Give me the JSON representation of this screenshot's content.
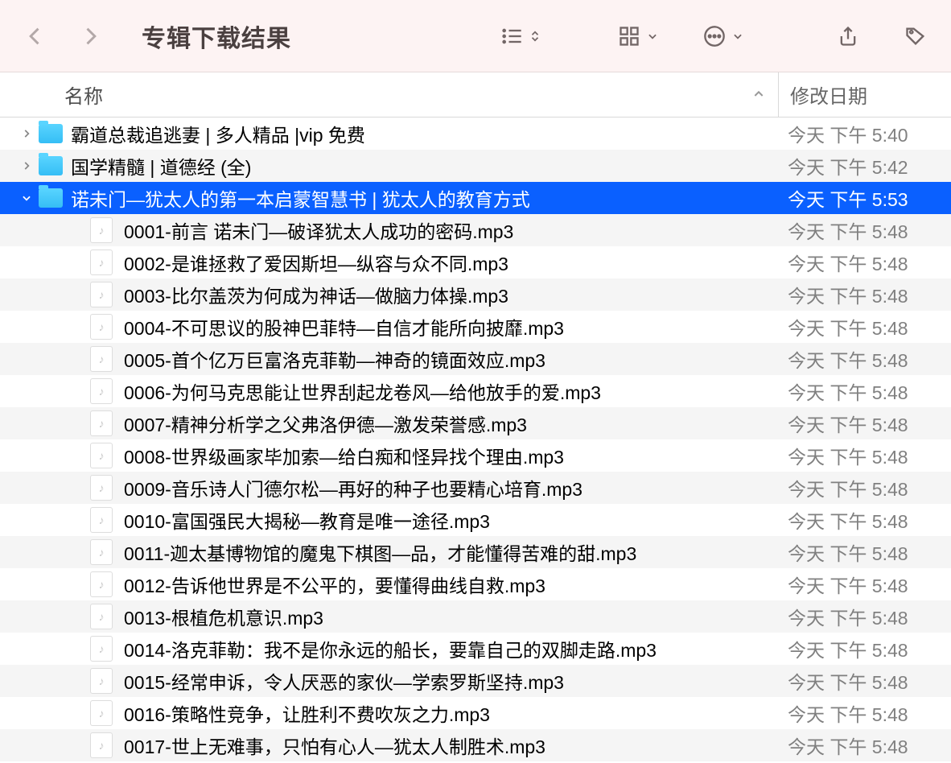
{
  "toolbar": {
    "title": "专辑下载结果"
  },
  "columns": {
    "name": "名称",
    "date": "修改日期"
  },
  "rows": [
    {
      "type": "folder",
      "depth": 0,
      "chev": "right",
      "name": "霸道总裁追逃妻 | 多人精品 |vip 免费",
      "date": "今天 下午 5:40",
      "dimDate": true,
      "selected": false
    },
    {
      "type": "folder",
      "depth": 0,
      "chev": "right",
      "name": "国学精髓 | 道德经 (全)",
      "date": "今天 下午 5:42",
      "dimDate": true,
      "selected": false
    },
    {
      "type": "folder",
      "depth": 0,
      "chev": "down",
      "name": "诺未门—犹太人的第一本启蒙智慧书 | 犹太人的教育方式",
      "date": "今天 下午 5:53",
      "dimDate": false,
      "selected": true
    },
    {
      "type": "file",
      "depth": 1,
      "name": "0001-前言 诺未门—破译犹太人成功的密码.mp3",
      "date": "今天 下午 5:48",
      "dimDate": true
    },
    {
      "type": "file",
      "depth": 1,
      "name": "0002-是谁拯救了爱因斯坦—纵容与众不同.mp3",
      "date": "今天 下午 5:48",
      "dimDate": true
    },
    {
      "type": "file",
      "depth": 1,
      "name": "0003-比尔盖茨为何成为神话—做脑力体操.mp3",
      "date": "今天 下午 5:48",
      "dimDate": true
    },
    {
      "type": "file",
      "depth": 1,
      "name": "0004-不可思议的股神巴菲特—自信才能所向披靡.mp3",
      "date": "今天 下午 5:48",
      "dimDate": true
    },
    {
      "type": "file",
      "depth": 1,
      "name": "0005-首个亿万巨富洛克菲勒—神奇的镜面效应.mp3",
      "date": "今天 下午 5:48",
      "dimDate": true
    },
    {
      "type": "file",
      "depth": 1,
      "name": "0006-为何马克思能让世界刮起龙卷风—给他放手的爱.mp3",
      "date": "今天 下午 5:48",
      "dimDate": true
    },
    {
      "type": "file",
      "depth": 1,
      "name": "0007-精神分析学之父弗洛伊德—激发荣誉感.mp3",
      "date": "今天 下午 5:48",
      "dimDate": true
    },
    {
      "type": "file",
      "depth": 1,
      "name": "0008-世界级画家毕加索—给白痴和怪异找个理由.mp3",
      "date": "今天 下午 5:48",
      "dimDate": true
    },
    {
      "type": "file",
      "depth": 1,
      "name": "0009-音乐诗人门德尔松—再好的种子也要精心培育.mp3",
      "date": "今天 下午 5:48",
      "dimDate": true
    },
    {
      "type": "file",
      "depth": 1,
      "name": "0010-富国强民大揭秘—教育是唯一途径.mp3",
      "date": "今天 下午 5:48",
      "dimDate": true
    },
    {
      "type": "file",
      "depth": 1,
      "name": "0011-迦太基博物馆的魔鬼下棋图—品，才能懂得苦难的甜.mp3",
      "date": "今天 下午 5:48",
      "dimDate": true
    },
    {
      "type": "file",
      "depth": 1,
      "name": "0012-告诉他世界是不公平的，要懂得曲线自救.mp3",
      "date": "今天 下午 5:48",
      "dimDate": true
    },
    {
      "type": "file",
      "depth": 1,
      "name": "0013-根植危机意识.mp3",
      "date": "今天 下午 5:48",
      "dimDate": true
    },
    {
      "type": "file",
      "depth": 1,
      "name": "0014-洛克菲勒：我不是你永远的船长，要靠自己的双脚走路.mp3",
      "date": "今天 下午 5:48",
      "dimDate": true
    },
    {
      "type": "file",
      "depth": 1,
      "name": "0015-经常申诉，令人厌恶的家伙—学索罗斯坚持.mp3",
      "date": "今天 下午 5:48",
      "dimDate": true
    },
    {
      "type": "file",
      "depth": 1,
      "name": "0016-策略性竞争，让胜利不费吹灰之力.mp3",
      "date": "今天 下午 5:48",
      "dimDate": true
    },
    {
      "type": "file",
      "depth": 1,
      "name": "0017-世上无难事，只怕有心人—犹太人制胜术.mp3",
      "date": "今天 下午 5:48",
      "dimDate": true
    }
  ]
}
